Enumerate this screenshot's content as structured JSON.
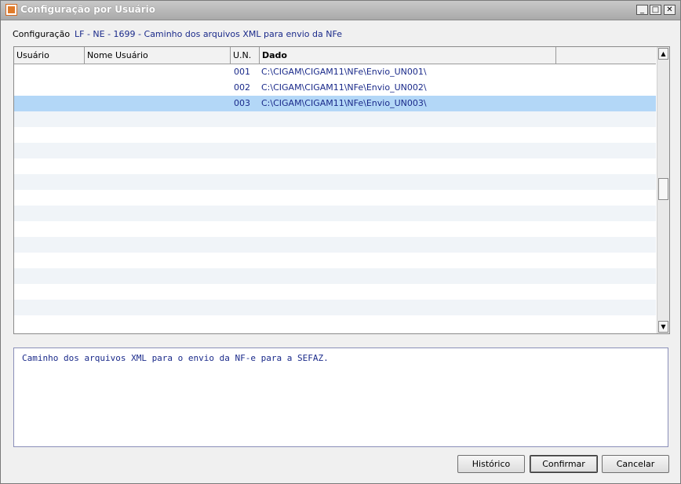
{
  "window": {
    "title": "Configuração por Usuário"
  },
  "config": {
    "label": "Configuração",
    "value": "LF - NE - 1699 - Caminho dos arquivos XML para envio da NFe"
  },
  "grid": {
    "columns": [
      "Usuário",
      "Nome Usuário",
      "U.N.",
      "Dado",
      ""
    ],
    "rows": [
      {
        "usuario": "",
        "nome": "",
        "un": "001",
        "dado": "C:\\CIGAM\\CIGAM11\\NFe\\Envio_UN001\\"
      },
      {
        "usuario": "",
        "nome": "",
        "un": "002",
        "dado": "C:\\CIGAM\\CIGAM11\\NFe\\Envio_UN002\\"
      },
      {
        "usuario": "",
        "nome": "",
        "un": "003",
        "dado": "C:\\CIGAM\\CIGAM11\\NFe\\Envio_UN003\\"
      }
    ]
  },
  "description": "Caminho dos arquivos XML para o envio da NF-e para a SEFAZ.",
  "buttons": {
    "historico": "Histórico",
    "confirmar": "Confirmar",
    "cancelar": "Cancelar"
  },
  "colors": {
    "accent": "#1a2a8a",
    "selection": "#b3d7f7"
  }
}
